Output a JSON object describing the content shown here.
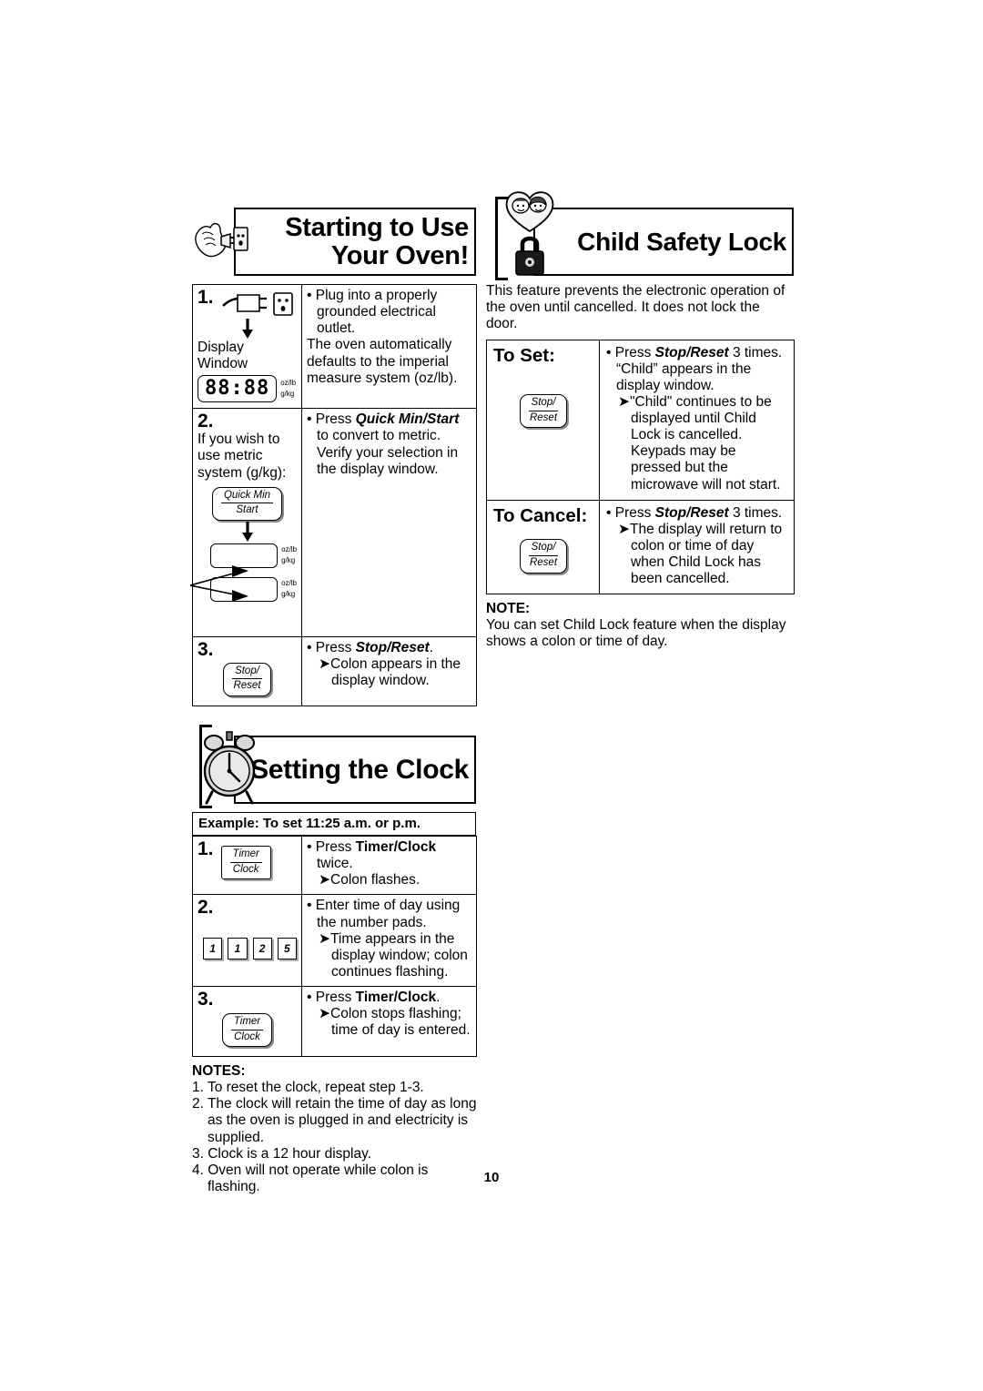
{
  "page": {
    "number": "10"
  },
  "starting": {
    "title_line1": "Starting to Use",
    "title_line2": "Your Oven!",
    "icon": "hand-plug-outlet-icon",
    "steps": [
      {
        "num": "1.",
        "display_label": "Display Window",
        "display_value": "88:88",
        "unit_top": "oz/lb",
        "unit_bottom": "g/kg",
        "bullet": "Plug into a properly grounded electrical outlet.",
        "extra": "The oven automatically defaults to the imperial measure system (oz/lb)."
      },
      {
        "num": "2.",
        "lead": "If you wish to use metric system (g/kg):",
        "button_top": "Quick Min",
        "button_bottom": "Start",
        "bullet_pre": "Press ",
        "bullet_bold": "Quick Min/Start",
        "bullet_post": " to convert to metric. Verify your selection in the display window.",
        "unit_top": "oz/lb",
        "unit_bottom": "g/kg"
      },
      {
        "num": "3.",
        "button_top": "Stop/",
        "button_bottom": "Reset",
        "bullet_pre": "Press ",
        "bullet_bold": "Stop/Reset",
        "bullet_post": ".",
        "arrow": "Colon appears in the display window."
      }
    ]
  },
  "clock": {
    "title": "Setting the Clock",
    "icon": "alarm-clock-icon",
    "example": "Example: To set 11:25 a.m. or p.m.",
    "steps": [
      {
        "num": "1.",
        "button_top": "Timer",
        "button_bottom": "Clock",
        "bullet_pre": "Press ",
        "bullet_bold": "Timer/Clock",
        "bullet_post": " twice.",
        "arrow": "Colon flashes."
      },
      {
        "num": "2.",
        "pads": [
          "1",
          "1",
          "2",
          "5"
        ],
        "bullet": "Enter time of day using the number pads.",
        "arrow": "Time appears in the display window; colon continues flashing."
      },
      {
        "num": "3.",
        "button_top": "Timer",
        "button_bottom": "Clock",
        "bullet_pre": "Press ",
        "bullet_bold": "Timer/Clock",
        "bullet_post": ".",
        "arrow": "Colon stops flashing; time of day is entered."
      }
    ],
    "notes_heading": "NOTES:",
    "notes": [
      "1. To reset the clock, repeat step 1-3.",
      "2. The clock will retain the time of day as long as the oven is plugged in and electricity is supplied.",
      "3. Clock is a 12 hour display.",
      "4. Oven will not operate while colon is flashing."
    ]
  },
  "child_lock": {
    "title": "Child Safety Lock",
    "icon": "children-padlock-icon",
    "intro": "This feature prevents the electronic operation of the oven until cancelled. It does not lock the door.",
    "to_set": {
      "heading": "To Set:",
      "button_top": "Stop/",
      "button_bottom": "Reset",
      "bullet_pre": "Press ",
      "bullet_bold": "Stop/Reset",
      "bullet_post": " 3 times. “Child” appears in the display window.",
      "arrow": "\"Child\" continues to be displayed until Child Lock is cancelled. Keypads may be pressed but the microwave will not start."
    },
    "to_cancel": {
      "heading": "To Cancel:",
      "button_top": "Stop/",
      "button_bottom": "Reset",
      "bullet_pre": "Press ",
      "bullet_bold": "Stop/Reset",
      "bullet_post": " 3 times.",
      "arrow": "The display will return to colon or time of day when Child Lock has been cancelled."
    },
    "note_heading": "NOTE:",
    "note_body": "You can set Child Lock feature when the display shows a colon or time of day."
  }
}
